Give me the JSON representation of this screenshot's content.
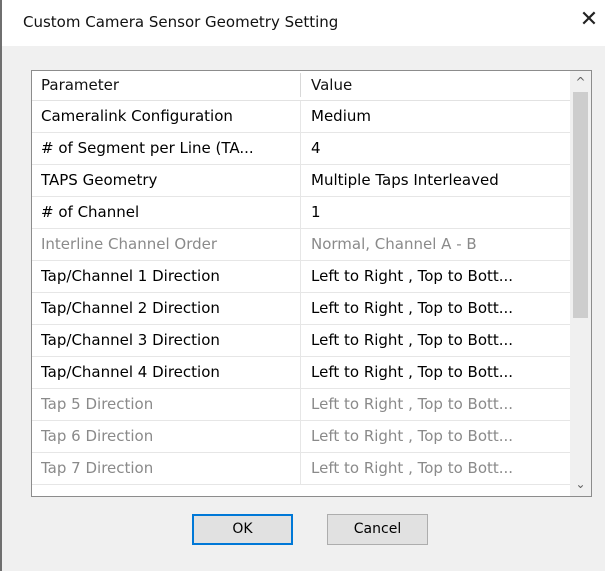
{
  "window": {
    "title": "Custom Camera Sensor Geometry Setting",
    "close_glyph": "✕"
  },
  "grid": {
    "headers": {
      "parameter": "Parameter",
      "value": "Value"
    },
    "rows": [
      {
        "parameter": "Cameralink Configuration",
        "value": "Medium",
        "enabled": true
      },
      {
        "parameter": "# of Segment per Line (TA...",
        "value": "4",
        "enabled": true
      },
      {
        "parameter": "TAPS Geometry",
        "value": "Multiple Taps Interleaved",
        "enabled": true
      },
      {
        "parameter": "# of Channel",
        "value": "1",
        "enabled": true
      },
      {
        "parameter": "Interline Channel Order",
        "value": "Normal, Channel A - B",
        "enabled": false
      },
      {
        "parameter": "Tap/Channel 1 Direction",
        "value": "Left to Right , Top to Bott...",
        "enabled": true
      },
      {
        "parameter": "Tap/Channel 2 Direction",
        "value": "Left to Right , Top to Bott...",
        "enabled": true
      },
      {
        "parameter": "Tap/Channel 3 Direction",
        "value": "Left to Right , Top to Bott...",
        "enabled": true
      },
      {
        "parameter": "Tap/Channel 4 Direction",
        "value": "Left to Right , Top to Bott...",
        "enabled": true
      },
      {
        "parameter": "Tap 5 Direction",
        "value": "Left to Right , Top to Bott...",
        "enabled": false
      },
      {
        "parameter": "Tap 6 Direction",
        "value": "Left to Right , Top to Bott...",
        "enabled": false
      },
      {
        "parameter": "Tap 7 Direction",
        "value": "Left to Right , Top to Bott...",
        "enabled": false
      }
    ],
    "scrollbar": {
      "up_glyph": "^",
      "down_glyph": "⌄"
    }
  },
  "buttons": {
    "ok": "OK",
    "cancel": "Cancel"
  }
}
